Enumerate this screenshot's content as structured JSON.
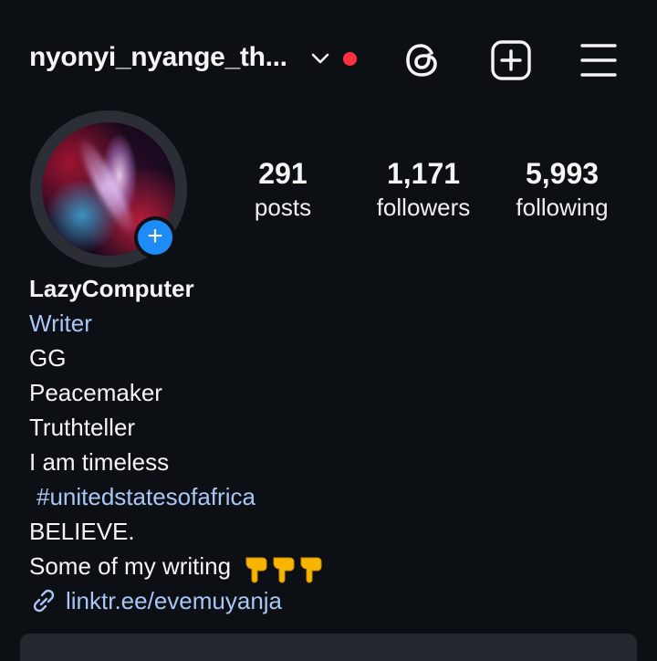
{
  "header": {
    "username": "nyonyi_nyange_th...",
    "icons": [
      "chevron-down-icon",
      "notification-dot",
      "threads-icon",
      "create-post-icon",
      "menu-icon"
    ]
  },
  "profile": {
    "stats": [
      {
        "value": "291",
        "label": "posts"
      },
      {
        "value": "1,171",
        "label": "followers"
      },
      {
        "value": "5,993",
        "label": "following"
      }
    ],
    "add_badge": "+"
  },
  "bio": {
    "name": "LazyComputer",
    "category": "Writer",
    "lines": [
      "GG",
      "Peacemaker",
      "Truthteller",
      "I am timeless"
    ],
    "hashtag": "#unitedstatesofafrica",
    "line_believe": "BELIEVE.",
    "writing_line": "Some of my writing",
    "link": "linktr.ee/evemuyanja"
  },
  "colors": {
    "background": "#0c0f14",
    "accent_blue": "#1d8cf8",
    "link_blue": "#a9c6f5",
    "notification_red": "#ff3040"
  }
}
